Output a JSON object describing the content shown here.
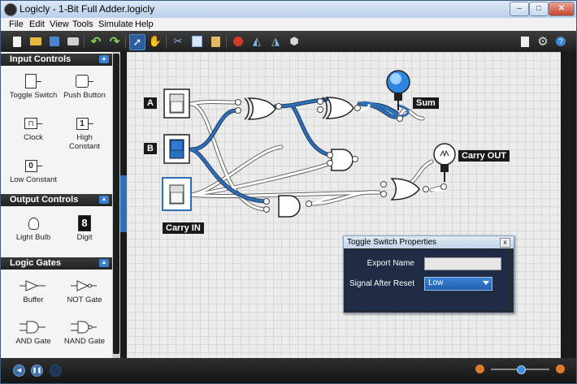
{
  "window": {
    "title": "Logicly - 1-Bit Full Adder.logicly",
    "min": "–",
    "max": "□",
    "close": "✕"
  },
  "menu": [
    "File",
    "Edit",
    "View",
    "Tools",
    "Simulate",
    "Help"
  ],
  "sidebar": {
    "sections": [
      {
        "title": "Input Controls",
        "collapse": "▲",
        "items": [
          {
            "label": "Toggle Switch",
            "icon": "toggle-switch-icon"
          },
          {
            "label": "Push Button",
            "icon": "push-button-icon"
          },
          {
            "label": "Clock",
            "icon": "clock-icon"
          },
          {
            "label": "High Constant",
            "icon": "high-constant-icon",
            "glyph": "1"
          },
          {
            "label": "Low Constant",
            "icon": "low-constant-icon",
            "glyph": "0"
          }
        ]
      },
      {
        "title": "Output Controls",
        "collapse": "▲",
        "items": [
          {
            "label": "Light Bulb",
            "icon": "light-bulb-icon"
          },
          {
            "label": "Digit",
            "icon": "digit-icon",
            "glyph": "8"
          }
        ]
      },
      {
        "title": "Logic Gates",
        "collapse": "▲",
        "items": [
          {
            "label": "Buffer",
            "icon": "buffer-gate-icon"
          },
          {
            "label": "NOT Gate",
            "icon": "not-gate-icon"
          },
          {
            "label": "AND Gate",
            "icon": "and-gate-icon"
          },
          {
            "label": "NAND Gate",
            "icon": "nand-gate-icon"
          }
        ]
      }
    ]
  },
  "canvas": {
    "labels": {
      "a": "A",
      "b": "B",
      "carry_in": "Carry IN",
      "sum": "Sum",
      "carry_out": "Carry OUT"
    }
  },
  "dialog": {
    "title": "Toggle Switch Properties",
    "close": "x",
    "export_name_label": "Export Name",
    "export_name_value": "",
    "signal_label": "Signal After Reset",
    "signal_value": "Low"
  },
  "colors": {
    "accent": "#2e6fb8",
    "wire_on": "#2e6fb8",
    "wire_off": "#ffffff"
  }
}
